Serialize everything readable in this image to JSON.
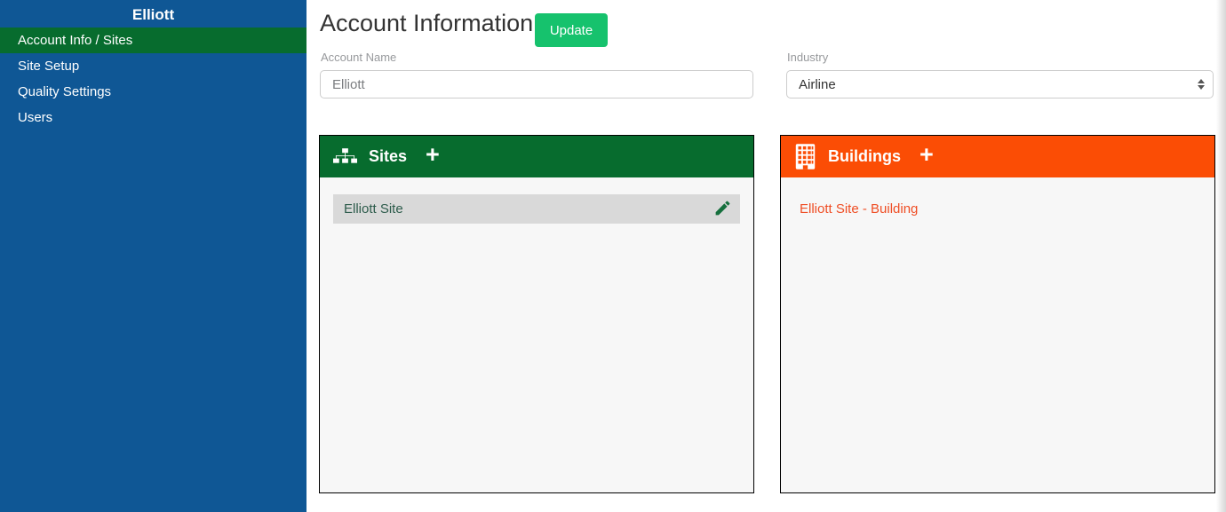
{
  "sidebar": {
    "title": "Elliott",
    "items": [
      {
        "label": "Account Info / Sites",
        "active": true
      },
      {
        "label": "Site Setup",
        "active": false
      },
      {
        "label": "Quality Settings",
        "active": false
      },
      {
        "label": "Users",
        "active": false
      }
    ]
  },
  "header": {
    "title": "Account Information",
    "update_label": "Update"
  },
  "form": {
    "account_name": {
      "label": "Account Name",
      "value": "Elliott"
    },
    "industry": {
      "label": "Industry",
      "value": "Airline"
    }
  },
  "sites_panel": {
    "title": "Sites",
    "add_label": "+",
    "items": [
      {
        "name": "Elliott Site"
      }
    ]
  },
  "buildings_panel": {
    "title": "Buildings",
    "add_label": "+",
    "links": [
      {
        "name": "Elliott Site - Building"
      }
    ]
  },
  "colors": {
    "sidebar-blue": "#0f5795",
    "active-green": "#076c2e",
    "panel-green": "#076c2e",
    "panel-orange": "#fb4d05",
    "button-green": "#16c26d",
    "link-orange": "#ef4e25",
    "site-row-text": "#2e5c4c",
    "pencil-green": "#156f3d"
  }
}
